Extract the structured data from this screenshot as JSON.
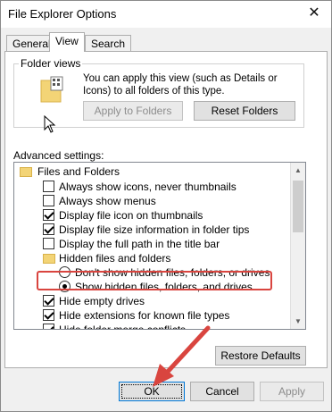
{
  "window": {
    "title": "File Explorer Options",
    "close_glyph": "✕"
  },
  "tabs": [
    {
      "label": "General"
    },
    {
      "label": "View"
    },
    {
      "label": "Search"
    }
  ],
  "folder_views": {
    "label": "Folder views",
    "description": "You can apply this view (such as Details or Icons) to all folders of this type.",
    "apply_button": "Apply to Folders",
    "reset_button": "Reset Folders"
  },
  "advanced": {
    "label": "Advanced settings:",
    "items": [
      {
        "type": "folder",
        "label": "Files and Folders",
        "checked": false
      },
      {
        "type": "checkbox",
        "label": "Always show icons, never thumbnails",
        "checked": false
      },
      {
        "type": "checkbox",
        "label": "Always show menus",
        "checked": false
      },
      {
        "type": "checkbox",
        "label": "Display file icon on thumbnails",
        "checked": true
      },
      {
        "type": "checkbox",
        "label": "Display file size information in folder tips",
        "checked": true
      },
      {
        "type": "checkbox",
        "label": "Display the full path in the title bar",
        "checked": false
      },
      {
        "type": "folder",
        "label": "Hidden files and folders",
        "checked": false
      },
      {
        "type": "radio",
        "label": "Don't show hidden files, folders, or drives",
        "checked": false
      },
      {
        "type": "radio",
        "label": "Show hidden files, folders, and drives",
        "checked": true
      },
      {
        "type": "checkbox",
        "label": "Hide empty drives",
        "checked": true
      },
      {
        "type": "checkbox",
        "label": "Hide extensions for known file types",
        "checked": true
      },
      {
        "type": "checkbox",
        "label": "Hide folder merge conflicts",
        "checked": true
      }
    ]
  },
  "restore_button": "Restore Defaults",
  "footer": {
    "ok": "OK",
    "cancel": "Cancel",
    "apply": "Apply"
  },
  "colors": {
    "highlight": "#d9453f",
    "focus": "#0078d7",
    "folder": "#f3d476"
  }
}
